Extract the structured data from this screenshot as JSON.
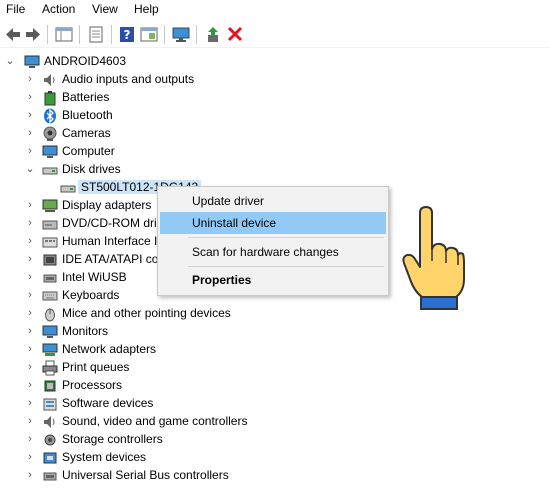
{
  "menubar": {
    "file": "File",
    "action": "Action",
    "view": "View",
    "help": "Help"
  },
  "toolbar": {
    "icons": [
      "back-arrow-icon",
      "forward-arrow-icon",
      "device-manager-icon",
      "properties-icon",
      "help-icon",
      "console-icon",
      "monitor-icon",
      "enable-device-icon",
      "uninstall-x-icon"
    ],
    "uninstall_color": "#e81123"
  },
  "tree": {
    "root": "ANDROID4603",
    "items": [
      {
        "label": "Audio inputs and outputs",
        "icon": "speaker-icon"
      },
      {
        "label": "Batteries",
        "icon": "battery-icon"
      },
      {
        "label": "Bluetooth",
        "icon": "bluetooth-icon"
      },
      {
        "label": "Cameras",
        "icon": "camera-icon"
      },
      {
        "label": "Computer",
        "icon": "computer-icon"
      },
      {
        "label": "Disk drives",
        "icon": "disk-drive-icon",
        "expanded": true
      },
      {
        "label": "Display adapters",
        "icon": "display-adapter-icon"
      },
      {
        "label": "DVD/CD-ROM dri",
        "icon": "dvd-drive-icon"
      },
      {
        "label": "Human Interface I",
        "icon": "hid-icon"
      },
      {
        "label": "IDE ATA/ATAPI co",
        "icon": "ide-controller-icon"
      },
      {
        "label": "Intel WiUSB",
        "icon": "usb-icon"
      },
      {
        "label": "Keyboards",
        "icon": "keyboard-icon"
      },
      {
        "label": "Mice and other pointing devices",
        "icon": "mouse-icon"
      },
      {
        "label": "Monitors",
        "icon": "monitor-icon"
      },
      {
        "label": "Network adapters",
        "icon": "network-adapter-icon"
      },
      {
        "label": "Print queues",
        "icon": "printer-icon"
      },
      {
        "label": "Processors",
        "icon": "processor-icon"
      },
      {
        "label": "Software devices",
        "icon": "software-device-icon"
      },
      {
        "label": "Sound, video and game controllers",
        "icon": "sound-icon"
      },
      {
        "label": "Storage controllers",
        "icon": "storage-controller-icon"
      },
      {
        "label": "System devices",
        "icon": "system-device-icon"
      },
      {
        "label": "Universal Serial Bus controllers",
        "icon": "usb-controller-icon"
      }
    ],
    "disk_child": "ST500LT012-1DG142"
  },
  "context_menu": {
    "update": "Update driver",
    "uninstall": "Uninstall device",
    "scan": "Scan for hardware changes",
    "properties": "Properties",
    "highlight_color": "#91c9f7"
  },
  "pointer": {
    "icon": "pointing-hand-icon"
  }
}
